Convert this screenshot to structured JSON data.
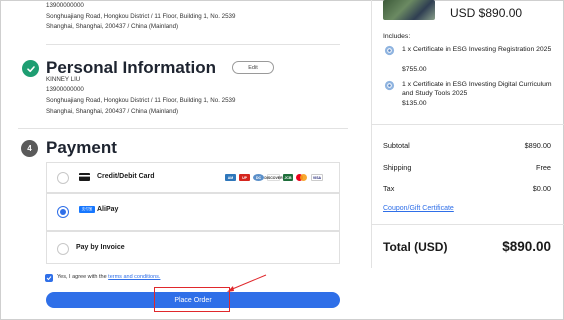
{
  "top_address": {
    "phone": "13900000000",
    "line1": "Songhuajiang Road, Hongkou District / 11 Floor, Building 1, No. 2539",
    "line2": "Shanghai, Shanghai, 200437 / China (Mainland)"
  },
  "personal_info": {
    "title": "Personal Information",
    "edit_label": "Edit",
    "name": "KINNEY LIU",
    "phone": "13900000000",
    "line1": "Songhuajiang Road, Hongkou District / 11 Floor, Building 1, No. 2539",
    "line2": "Shanghai, Shanghai, 200437 / China (Mainland)"
  },
  "payment": {
    "step": "4",
    "title": "Payment",
    "options": [
      {
        "label": "Credit/Debit Card",
        "selected": false
      },
      {
        "label": "AliPay",
        "selected": true
      },
      {
        "label": "Pay by Invoice",
        "selected": false
      }
    ],
    "card_logos": [
      {
        "icon": "amex-logo",
        "text": "AM",
        "color": "#2e77bb"
      },
      {
        "icon": "unionpay-logo",
        "text": "UP",
        "color": "#d5261e"
      },
      {
        "icon": "dinersclub-logo",
        "text": "DC",
        "color": "#5a8fc9"
      },
      {
        "icon": "discover-logo",
        "text": "DISCOVER",
        "color": "#f18a24"
      },
      {
        "icon": "jcb-logo",
        "text": "JCB",
        "color": "#1e6e3a"
      },
      {
        "icon": "mastercard-logo",
        "text": "",
        "color": "#eb001b"
      },
      {
        "icon": "visa-logo",
        "text": "VISA",
        "color": "#1a1f71"
      }
    ],
    "alipay_logo_text": "支付宝",
    "agree_prefix": "Yes, I agree with the",
    "agree_link": "terms and conditions.",
    "place_order": "Place Order"
  },
  "order_summary": {
    "item_price": "USD $890.00",
    "includes_label": "Includes:",
    "includes": [
      {
        "name": "1 x Certificate in ESG Investing Registration 2025",
        "price": "$755.00"
      },
      {
        "name": "1 x Certificate in ESG Investing Digital Curriculum and Study Tools 2025",
        "price": "$135.00"
      }
    ],
    "subtotal_label": "Subtotal",
    "subtotal": "$890.00",
    "shipping_label": "Shipping",
    "shipping": "Free",
    "tax_label": "Tax",
    "tax": "$0.00",
    "coupon_label": "Coupon/Gift Certificate",
    "total_label": "Total (USD)",
    "total": "$890.00"
  },
  "colors": {
    "accent": "#2f6fe8",
    "success": "#1e9e72",
    "highlight": "#e0282c"
  }
}
